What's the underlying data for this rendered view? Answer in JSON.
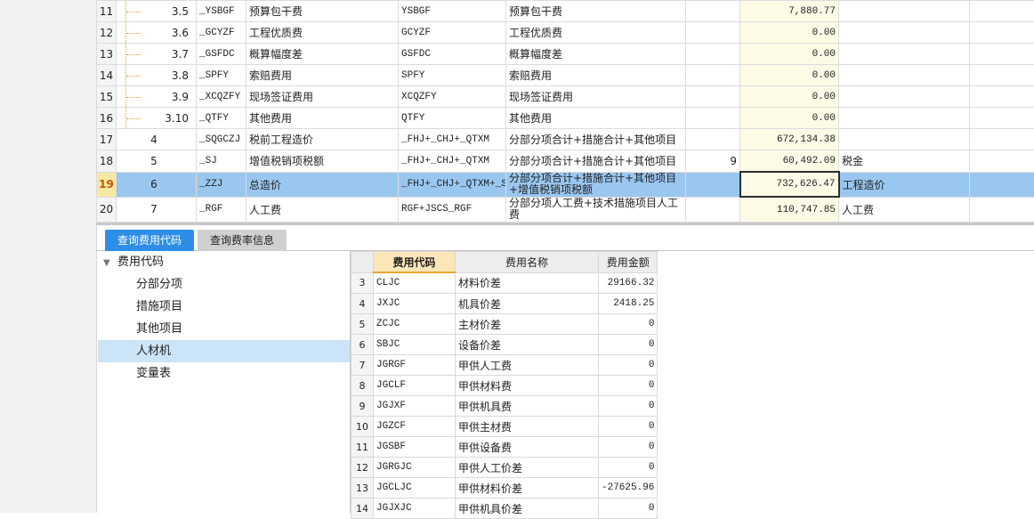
{
  "top_rows": [
    {
      "rownum": "11",
      "seq": "3.5",
      "code": "_YSBGF",
      "name": "预算包干费",
      "base": "YSBGF",
      "base_desc": "预算包干费",
      "rate": "",
      "amount": "7,880.77",
      "type": "",
      "tree": true
    },
    {
      "rownum": "12",
      "seq": "3.6",
      "code": "_GCYZF",
      "name": "工程优质费",
      "base": "GCYZF",
      "base_desc": "工程优质费",
      "rate": "",
      "amount": "0.00",
      "type": "",
      "tree": true
    },
    {
      "rownum": "13",
      "seq": "3.7",
      "code": "_GSFDC",
      "name": "概算幅度差",
      "base": "GSFDC",
      "base_desc": "概算幅度差",
      "rate": "",
      "amount": "0.00",
      "type": "",
      "tree": true
    },
    {
      "rownum": "14",
      "seq": "3.8",
      "code": "_SPFY",
      "name": "索赔费用",
      "base": "SPFY",
      "base_desc": "索赔费用",
      "rate": "",
      "amount": "0.00",
      "type": "",
      "tree": true
    },
    {
      "rownum": "15",
      "seq": "3.9",
      "code": "_XCQZFY",
      "name": "现场签证费用",
      "base": "XCQZFY",
      "base_desc": "现场签证费用",
      "rate": "",
      "amount": "0.00",
      "type": "",
      "tree": true
    },
    {
      "rownum": "16",
      "seq": "3.10",
      "code": "_QTFY",
      "name": "其他费用",
      "base": "QTFY",
      "base_desc": "其他费用",
      "rate": "",
      "amount": "0.00",
      "type": "",
      "tree": true
    },
    {
      "rownum": "17",
      "seq": "4",
      "code": "_SQGCZJ",
      "name": "税前工程造价",
      "base": "_FHJ+_CHJ+_QTXM",
      "base_desc": "分部分项合计+措施合计+其他项目",
      "rate": "",
      "amount": "672,134.38",
      "type": "",
      "tree": false
    },
    {
      "rownum": "18",
      "seq": "5",
      "code": "_SJ",
      "name": "增值税销项税额",
      "base": "_FHJ+_CHJ+_QTXM",
      "base_desc": "分部分项合计+措施合计+其他项目",
      "rate": "9",
      "amount": "60,492.09",
      "type": "税金",
      "tree": false
    },
    {
      "rownum": "19",
      "seq": "6",
      "code": "_ZZJ",
      "name": "总造价",
      "base": "_FHJ+_CHJ+_QTXM+_SJ",
      "base_desc": "分部分项合计+措施合计+其他项目+增值税销项税额",
      "rate": "",
      "amount": "732,626.47",
      "type": "工程造价",
      "tree": false,
      "selected": true
    },
    {
      "rownum": "20",
      "seq": "7",
      "code": "_RGF",
      "name": "人工费",
      "base": "RGF+JSCS_RGF",
      "base_desc": "分部分项人工费+技术措施项目人工费",
      "rate": "",
      "amount": "110,747.85",
      "type": "人工费",
      "tree": false,
      "tall": true
    }
  ],
  "tabs": {
    "tab1": "查询费用代码",
    "tab2": "查询费率信息"
  },
  "tree": {
    "root": "费用代码",
    "children": [
      "分部分项",
      "措施项目",
      "其他项目",
      "人材机",
      "变量表"
    ],
    "selected": "人材机"
  },
  "bottom_table": {
    "headers": [
      "费用代码",
      "费用名称",
      "费用金额"
    ],
    "rows": [
      {
        "n": "3",
        "code": "CLJC",
        "name": "材料价差",
        "amount": "29166.32"
      },
      {
        "n": "4",
        "code": "JXJC",
        "name": "机具价差",
        "amount": "2418.25"
      },
      {
        "n": "5",
        "code": "ZCJC",
        "name": "主材价差",
        "amount": "0"
      },
      {
        "n": "6",
        "code": "SBJC",
        "name": "设备价差",
        "amount": "0"
      },
      {
        "n": "7",
        "code": "JGRGF",
        "name": "甲供人工费",
        "amount": "0"
      },
      {
        "n": "8",
        "code": "JGCLF",
        "name": "甲供材料费",
        "amount": "0"
      },
      {
        "n": "9",
        "code": "JGJXF",
        "name": "甲供机具费",
        "amount": "0"
      },
      {
        "n": "10",
        "code": "JGZCF",
        "name": "甲供主材费",
        "amount": "0"
      },
      {
        "n": "11",
        "code": "JGSBF",
        "name": "甲供设备费",
        "amount": "0"
      },
      {
        "n": "12",
        "code": "JGRGJC",
        "name": "甲供人工价差",
        "amount": "0"
      },
      {
        "n": "13",
        "code": "JGCLJC",
        "name": "甲供材料价差",
        "amount": "-27625.96"
      },
      {
        "n": "14",
        "code": "JGJXJC",
        "name": "甲供机具价差",
        "amount": "0"
      }
    ]
  },
  "colors": {
    "selected_row": "#99c7f0",
    "active_tab": "#2e8ee6",
    "amount_bg": "#fdfbe6",
    "tree_selected": "#cce4f7"
  }
}
